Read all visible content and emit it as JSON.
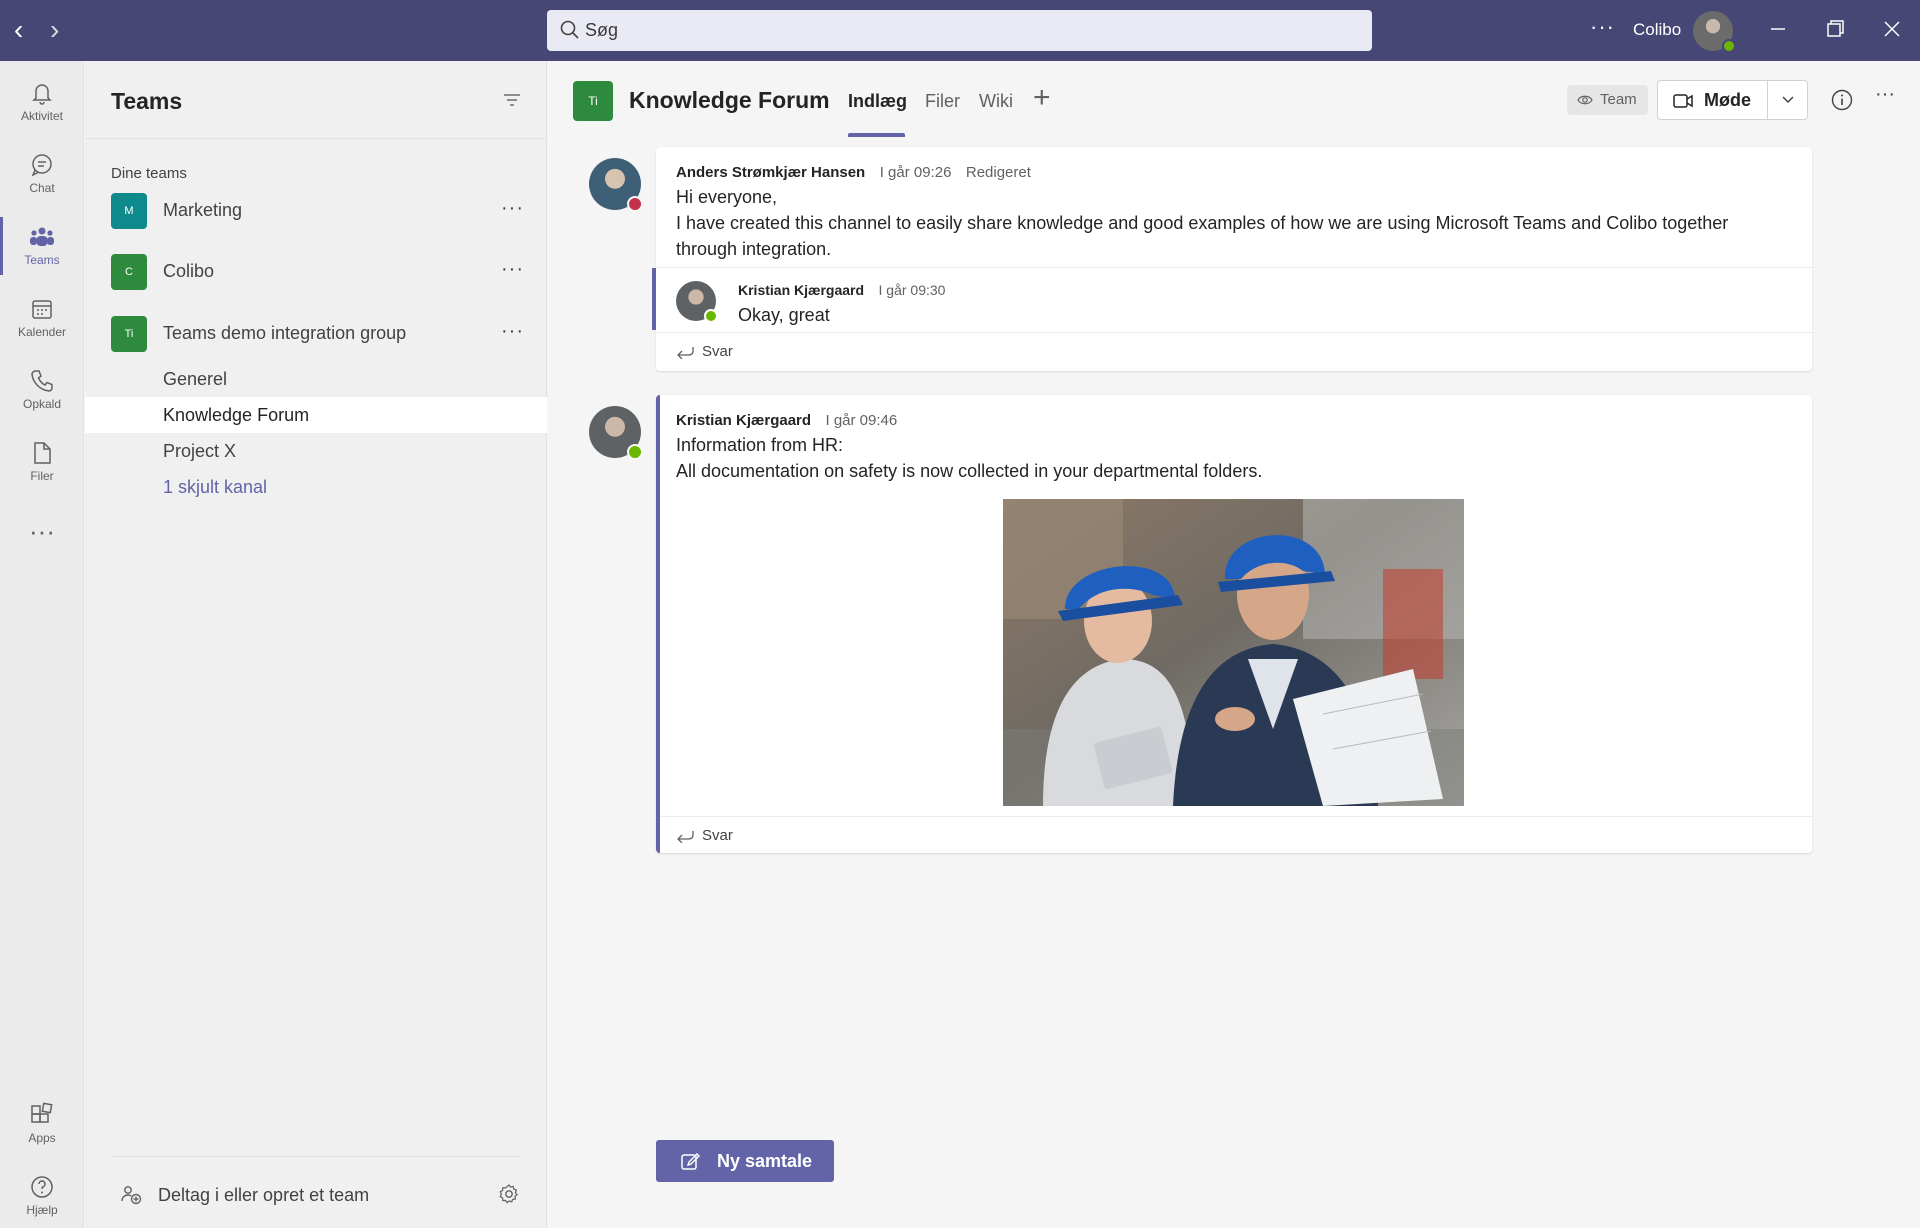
{
  "titlebar": {
    "search_placeholder": "Søg",
    "more": "···",
    "user_name": "Colibo"
  },
  "rail": {
    "items": [
      {
        "label": "Aktivitet",
        "icon": "bell-icon"
      },
      {
        "label": "Chat",
        "icon": "chat-icon"
      },
      {
        "label": "Teams",
        "icon": "teams-icon",
        "active": true
      },
      {
        "label": "Kalender",
        "icon": "calendar-icon"
      },
      {
        "label": "Opkald",
        "icon": "phone-icon"
      },
      {
        "label": "Filer",
        "icon": "file-icon"
      }
    ],
    "more": "···",
    "apps": "Apps",
    "help": "Hjælp"
  },
  "pane": {
    "title": "Teams",
    "section_label": "Dine teams",
    "teams": [
      {
        "name": "Marketing",
        "initial": "M",
        "color": "#0f8a8c"
      },
      {
        "name": "Colibo",
        "initial": "C",
        "color": "#2e8b3e"
      },
      {
        "name": "Teams demo integration group",
        "initial": "Ti",
        "color": "#2e8b3e"
      }
    ],
    "team_more": "···",
    "channels": [
      {
        "name": "Generel"
      },
      {
        "name": "Knowledge Forum",
        "selected": true
      },
      {
        "name": "Project X"
      },
      {
        "name": "1 skjult kanal",
        "link": true
      }
    ],
    "join_label": "Deltag i eller opret et team"
  },
  "channel": {
    "tile": "Ti",
    "title": "Knowledge Forum",
    "tabs": [
      "Indlæg",
      "Filer",
      "Wiki"
    ],
    "add": "+",
    "team_badge": "Team",
    "meet_label": "Møde",
    "more": "···"
  },
  "messages": [
    {
      "author": "Anders Strømkjær Hansen",
      "time": "I går 09:26",
      "edited": "Redigeret",
      "lines": [
        "Hi everyone,",
        "I have created this channel to easily share knowledge and good examples of how we are using Microsoft Teams and Colibo together through integration."
      ],
      "reply": {
        "author": "Kristian Kjærgaard",
        "time": "I går 09:30",
        "text": "Okay, great"
      },
      "reply_label": "Svar"
    },
    {
      "author": "Kristian Kjærgaard",
      "time": "I går 09:46",
      "lines": [
        "Information from HR:",
        "All documentation on safety is now collected in your departmental folders."
      ],
      "image": "photo-two-workers-in-blue-hard-hats-reviewing-blueprint",
      "reply_label": "Svar"
    }
  ],
  "new_conversation": "Ny samtale",
  "colors": {
    "titlebar": "#464775",
    "accent": "#6264a7",
    "status_available": "#6bb700",
    "status_busy": "#c4314b"
  }
}
